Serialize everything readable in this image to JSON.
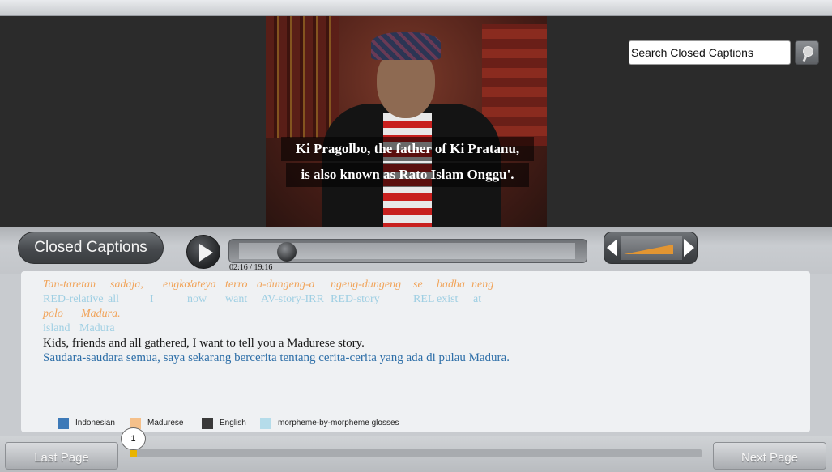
{
  "video": {
    "subtitle_line1": "Ki Pragolbo, the father of Ki Pratanu,",
    "subtitle_line2": "is also known as Rato Islam Onggu'."
  },
  "search": {
    "placeholder": "Search Closed Captions",
    "icon": "search-icon"
  },
  "controls": {
    "cc_label": "Closed Captions",
    "time": "02:16 / 19:16",
    "progress_fraction": 0.12,
    "volume_fraction": 0.85
  },
  "captions": {
    "madurese_words": [
      "Tan-taretan",
      "sadaja,",
      "engko'",
      "sateya",
      "terro",
      "a-dungeng-a",
      "ngeng-dungeng",
      "se",
      "badha",
      "neng",
      "polo",
      "Madura."
    ],
    "gloss_words": [
      "RED-relative",
      "all",
      "I",
      "now",
      "want",
      "AV-story-IRR",
      "RED-story",
      "REL",
      "exist",
      "at",
      "island",
      "Madura"
    ],
    "english": "Kids, friends and all gathered, I want to tell you a Madurese story.",
    "indonesian": "Saudara-saudara semua, saya sekarang bercerita tentang cerita-cerita yang ada di pulau Madura."
  },
  "legend": [
    {
      "label": "Indonesian",
      "color": "#3d7ab8"
    },
    {
      "label": "Madurese",
      "color": "#f5c08a"
    },
    {
      "label": "English",
      "color": "#3a3a3a"
    },
    {
      "label": "morpheme-by-morpheme glosses",
      "color": "#b5dcea"
    }
  ],
  "pager": {
    "prev_label": "Last Page",
    "next_label": "Next Page",
    "current_page": "1",
    "page_fraction": 0.0
  }
}
